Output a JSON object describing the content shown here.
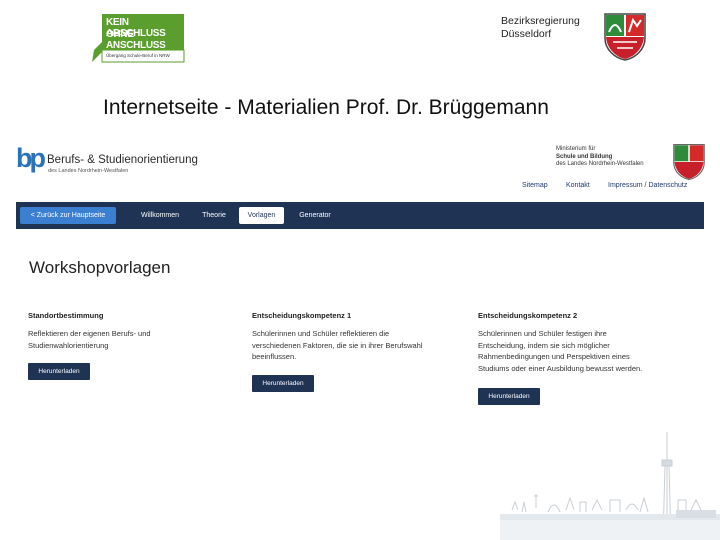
{
  "slide": {
    "kaoa_logo": {
      "line1": "KEIN ABSCHLUSS",
      "line2": "OHNE ANSCHLUSS",
      "sub": "Übergang Schule-Beruf in NRW"
    },
    "authority": {
      "line1": "Bezirksregierung",
      "line2": "Düsseldorf"
    },
    "title": "Internetseite - Materialien Prof. Dr. Brüggemann",
    "colors": {
      "green": "#5a9e2e",
      "navy": "#1f3355",
      "accent_blue": "#3a7fd0"
    }
  },
  "site": {
    "logo": {
      "mark": "bp",
      "name": "Berufs- & Studienorientierung",
      "sub": "des Landes Nordrhein-Westfalen"
    },
    "ministry": {
      "line1": "Ministerium für",
      "line2": "Schule und Bildung",
      "line3": "des Landes Nordrhein-Westfalen"
    },
    "top_links": [
      "Sitemap",
      "Kontakt",
      "Impressum / Datenschutz"
    ],
    "nav": {
      "back": "< Zurück zur Hauptseite",
      "items": [
        "Willkommen",
        "Theorie",
        "Vorlagen",
        "Generator"
      ],
      "active": "Vorlagen"
    },
    "heading": "Workshopvorlagen",
    "columns": [
      {
        "title": "Standortbestimmung",
        "lines": [
          "Reflektieren der eigenen Berufs- und",
          "Studienwahlorientierung"
        ],
        "button": "Herunterladen"
      },
      {
        "title": "Entscheidungskompetenz 1",
        "lines": [
          "Schülerinnen und Schüler reflektieren die",
          "verschiedenen Faktoren, die sie in ihrer Berufswahl",
          "beeinflussen."
        ],
        "button": "Herunterladen"
      },
      {
        "title": "Entscheidungskompetenz 2",
        "lines": [
          "Schülerinnen und Schüler festigen ihre",
          "Entscheidung, indem sie sich möglicher",
          "Rahmenbedingungen und Perspektiven eines",
          "Studiums oder einer Ausbildung bewusst werden."
        ],
        "button": "Herunterladen"
      }
    ]
  }
}
